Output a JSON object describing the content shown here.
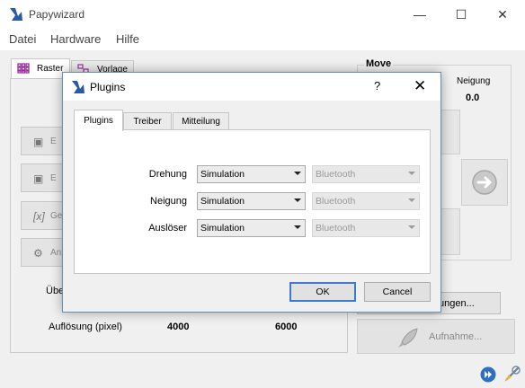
{
  "app": {
    "title": "Papywizard",
    "min": "—",
    "max": "☐",
    "close": "✕"
  },
  "menu": [
    "Datei",
    "Hardware",
    "Hilfe"
  ],
  "main_tabs": [
    {
      "label": "Raster",
      "icon": "grid-icon"
    },
    {
      "label": "Vorlage",
      "icon": "template-icon"
    }
  ],
  "side_buttons": [
    {
      "icon": "shoot-icon",
      "label": "E"
    },
    {
      "icon": "shoot-icon",
      "label": "E"
    },
    {
      "icon": "formula-icon",
      "label": "Ge"
    },
    {
      "icon": "sliders-icon",
      "label": "Anz"
    }
  ],
  "main": {
    "ueber_label": "Übe",
    "aufloesung_label": "Auflösung (pixel)",
    "aufloesung_x": "4000",
    "aufloesung_y": "6000",
    "settings_button_partial": "ungen...",
    "aufnahme_label": "Aufnahme..."
  },
  "move": {
    "title": "Move",
    "neigung_label": "Neigung",
    "neigung_value": "0.0"
  },
  "dialog": {
    "title": "Plugins",
    "help": "?",
    "close": "✕",
    "tabs": [
      "Plugins",
      "Treiber",
      "Mitteilung"
    ],
    "rows": [
      {
        "label": "Drehung",
        "plugin": "Simulation",
        "driver": "Bluetooth"
      },
      {
        "label": "Neigung",
        "plugin": "Simulation",
        "driver": "Bluetooth"
      },
      {
        "label": "Auslöser",
        "plugin": "Simulation",
        "driver": "Bluetooth"
      }
    ],
    "ok": "OK",
    "cancel": "Cancel"
  },
  "colors": {
    "accent": "#3b7ad0",
    "tab_icon": "#9b2fa0",
    "logo": "#2a5aa6"
  }
}
